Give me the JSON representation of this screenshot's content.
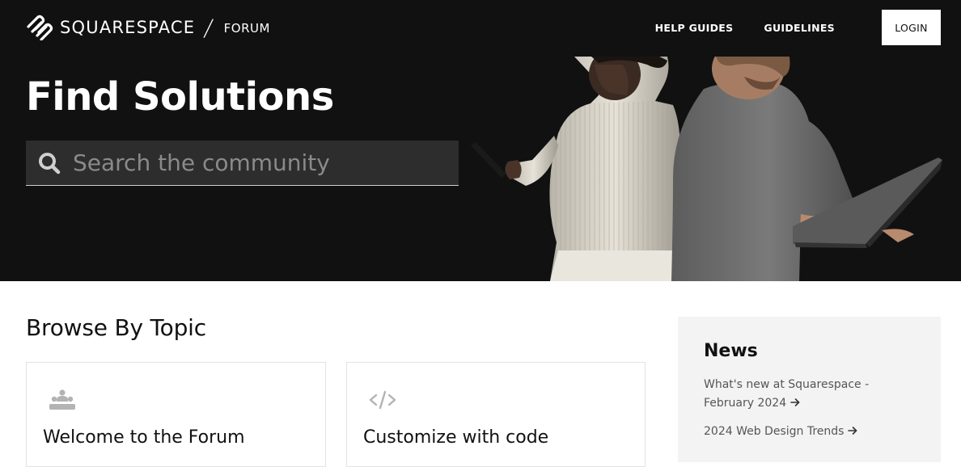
{
  "header": {
    "brand": "SQUARESPACE",
    "section": "FORUM",
    "nav": [
      {
        "label": "HELP GUIDES"
      },
      {
        "label": "GUIDELINES"
      }
    ],
    "login_label": "LOGIN"
  },
  "hero": {
    "title": "Find Solutions",
    "search_placeholder": "Search the community",
    "search_value": ""
  },
  "browse": {
    "title": "Browse By Topic",
    "topics": [
      {
        "title": "Welcome to the Forum",
        "icon": "community-icon"
      },
      {
        "title": "Customize with code",
        "icon": "code-icon"
      }
    ]
  },
  "news": {
    "title": "News",
    "items": [
      {
        "label": "What's new at Squarespace - February 2024"
      },
      {
        "label": "2024 Web Design Trends"
      }
    ]
  },
  "colors": {
    "hero_bg": "#111111",
    "search_bg": "#2d2d2d",
    "news_bg": "#f3f3f3",
    "card_border": "#e3e3e3"
  }
}
